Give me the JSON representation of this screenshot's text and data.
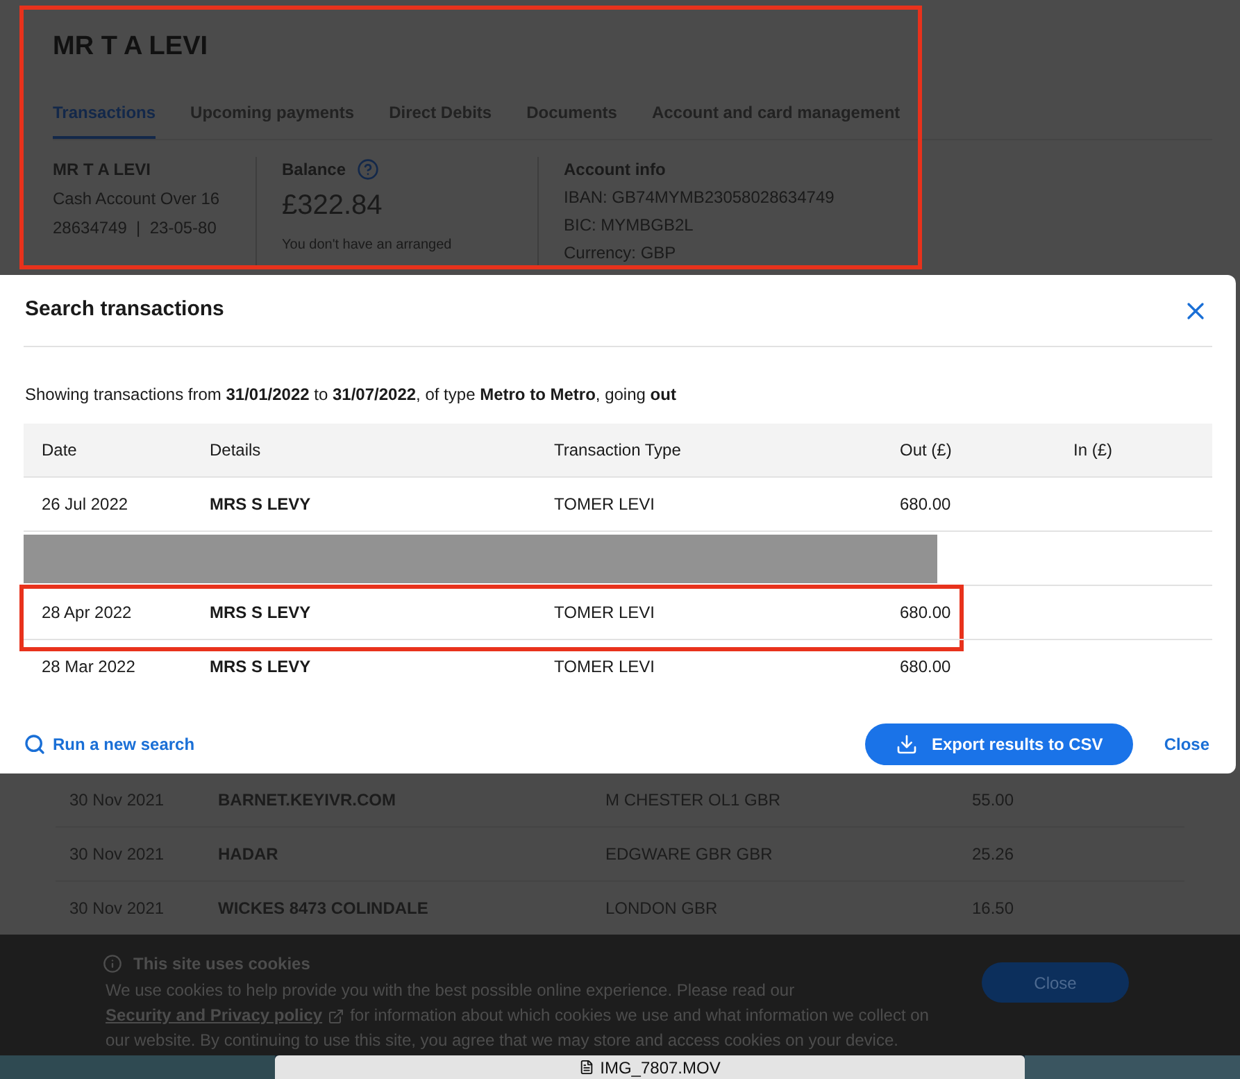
{
  "account": {
    "name": "MR T A LEVI",
    "tabs": [
      {
        "label": "Transactions",
        "selected": true
      },
      {
        "label": "Upcoming payments",
        "selected": false
      },
      {
        "label": "Direct Debits",
        "selected": false
      },
      {
        "label": "Documents",
        "selected": false
      },
      {
        "label": "Account and card management",
        "selected": false
      }
    ],
    "holder": {
      "name": "MR T A LEVI",
      "product": "Cash Account Over 16",
      "numbers": "28634749  |  23-05-80"
    },
    "balance": {
      "label": "Balance",
      "amount": "£322.84",
      "note": "You don't have an arranged"
    },
    "account_info": {
      "title": "Account info",
      "lines": [
        "IBAN: GB74MYMB23058028634749",
        "BIC: MYMBGB2L",
        "Currency: GBP"
      ]
    },
    "highlighted": true
  },
  "modal": {
    "title": "Search transactions",
    "summary": "Showing transactions from **31/01/2022** to **31/07/2022**, of type **Metro to Metro**, going **out**",
    "columns": [
      "Date",
      "Details",
      "Transaction Type",
      "Out (£)",
      "In (£)"
    ],
    "rows": [
      {
        "kind": "transaction",
        "date": "26 Jul 2022",
        "details": "MRS S LEVY",
        "type": "TOMER LEVI",
        "out": "680.00",
        "highlighted": false
      },
      {
        "kind": "redacted"
      },
      {
        "kind": "transaction",
        "date": "28 Apr 2022",
        "details": "MRS S LEVY",
        "type": "TOMER LEVI",
        "out": "680.00",
        "highlighted": true
      },
      {
        "kind": "transaction",
        "date": "28 Mar 2022",
        "details": "MRS S LEVY",
        "type": "TOMER LEVI",
        "out": "680.00",
        "highlighted": false
      }
    ],
    "new_search": "Run a new search",
    "export": "Export results to CSV",
    "close": "Close"
  },
  "background_rows": [
    {
      "date": "30 Nov 2021",
      "details": "BARNET.KEYIVR.COM",
      "location": "M CHESTER OL1  GBR",
      "amount": "55.00"
    },
    {
      "date": "30 Nov 2021",
      "details": "HADAR",
      "location": "EDGWARE GBR GBR",
      "amount": "25.26"
    },
    {
      "date": "30 Nov 2021",
      "details": "WICKES 8473 COLINDALE",
      "location": "LONDON  GBR",
      "amount": "16.50"
    }
  ],
  "cookie_banner": {
    "title": "This site uses cookies",
    "text_before": "We use cookies to help provide you with the best possible online experience. Please read our",
    "link": "Security and Privacy policy",
    "text_after": "for information about which cookies we use and what information we collect on our website. By continuing to use this site, you agree that we may store and access cookies on your device.",
    "button": "Close"
  },
  "taskbar": {
    "file": "IMG_7807.MOV"
  }
}
